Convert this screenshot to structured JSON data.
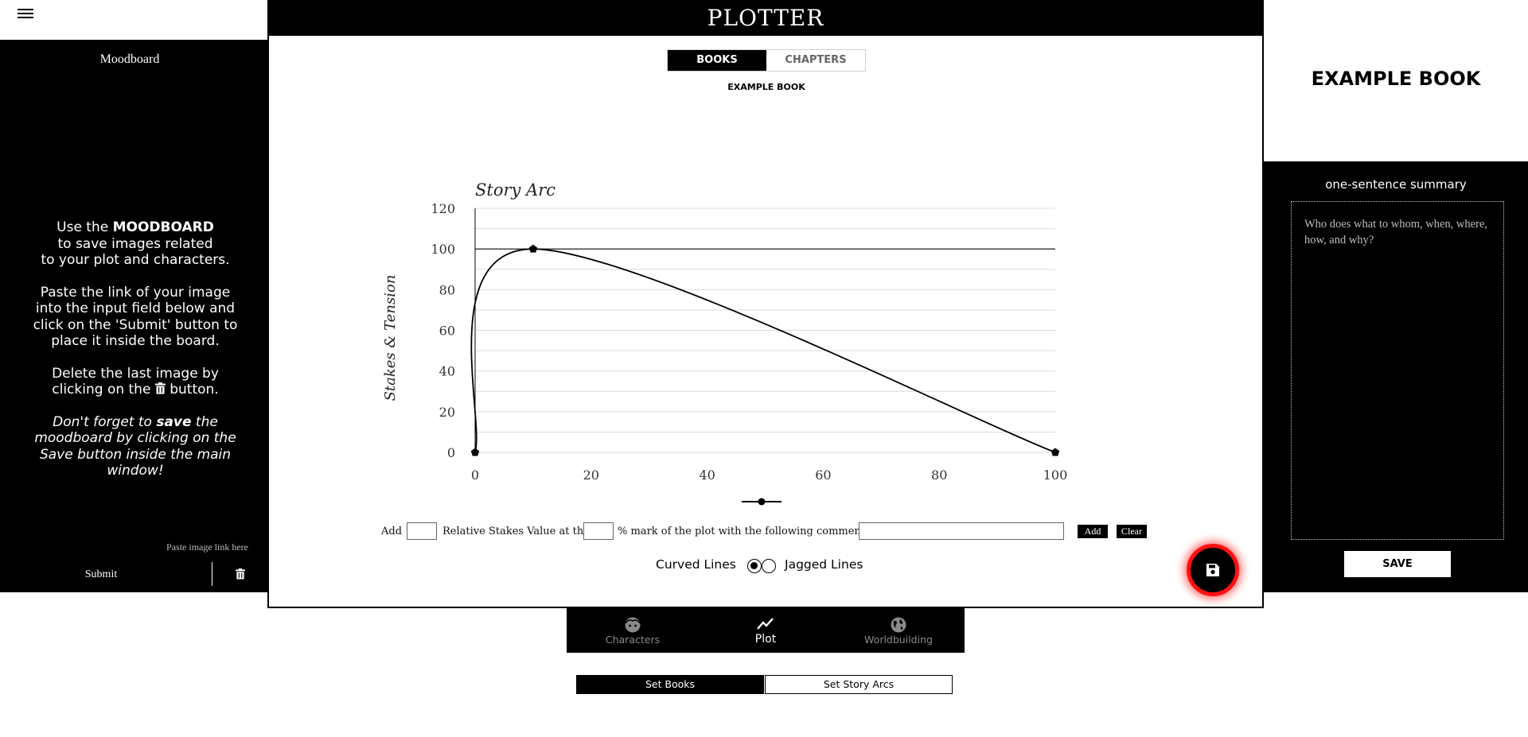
{
  "app": {
    "title": "PLOTTER"
  },
  "moodboard": {
    "title": "Moodboard",
    "instructions": {
      "p1_pre": "Use the ",
      "p1_bold": "MOODBOARD",
      "p1_line2": "to save images related",
      "p1_line3": "to your plot and characters.",
      "p2_line1": "Paste the link of your image",
      "p2_line2": "into the input field below and",
      "p2_line3": "click on the 'Submit' button to",
      "p2_line4": "place it inside the board.",
      "p3_line1": "Delete the last image by",
      "p3_pre": "clicking on the ",
      "p3_post": " button.",
      "p4_pre": "Don't forget to ",
      "p4_bold": "save",
      "p4_post": " the",
      "p4_line2": "moodboard by clicking on the",
      "p4_line3": "Save button inside the main",
      "p4_line4": "window!"
    },
    "paste_placeholder": "Paste image link here",
    "submit_label": "Submit"
  },
  "main": {
    "tabs": [
      {
        "label": "BOOKS",
        "active": true
      },
      {
        "label": "CHAPTERS",
        "active": false
      }
    ],
    "book_name": "EXAMPLE BOOK",
    "add_row": {
      "label_add": "Add",
      "label_stakes": "Relative Stakes Value at the",
      "label_mark": "% mark of the plot with the following comment:",
      "add_button": "Add",
      "clear_button": "Clear"
    },
    "line_style": {
      "curved_label": "Curved Lines",
      "jagged_label": "Jagged Lines",
      "selected": "curved"
    }
  },
  "right_panel": {
    "book_title": "EXAMPLE BOOK",
    "summary_label": "one-sentence summary",
    "summary_placeholder": "Who does what to whom, when, where, how, and why?",
    "save_label": "SAVE"
  },
  "bottom_nav": {
    "items": [
      {
        "label": "Characters",
        "icon": "face-icon",
        "active": false
      },
      {
        "label": "Plot",
        "icon": "trending-line-icon",
        "active": true
      },
      {
        "label": "Worldbuilding",
        "icon": "globe-icon",
        "active": false
      }
    ]
  },
  "set_tabs": [
    {
      "label": "Set Books",
      "active": true
    },
    {
      "label": "Set Story Arcs",
      "active": false
    }
  ],
  "chart_data": {
    "type": "line",
    "title": "Story Arc",
    "xlabel": "",
    "ylabel": "Stakes & Tension",
    "x_ticks": [
      "0",
      "20",
      "40",
      "60",
      "80",
      "100"
    ],
    "y_ticks": [
      "0",
      "20",
      "40",
      "60",
      "80",
      "100",
      "120"
    ],
    "xlim": [
      0,
      100
    ],
    "ylim": [
      0,
      120
    ],
    "reference_line_y": 100,
    "grid": true,
    "curved": true,
    "points": [
      {
        "x": 0,
        "y": 0
      },
      {
        "x": 10,
        "y": 100
      },
      {
        "x": 100,
        "y": 0
      }
    ]
  }
}
